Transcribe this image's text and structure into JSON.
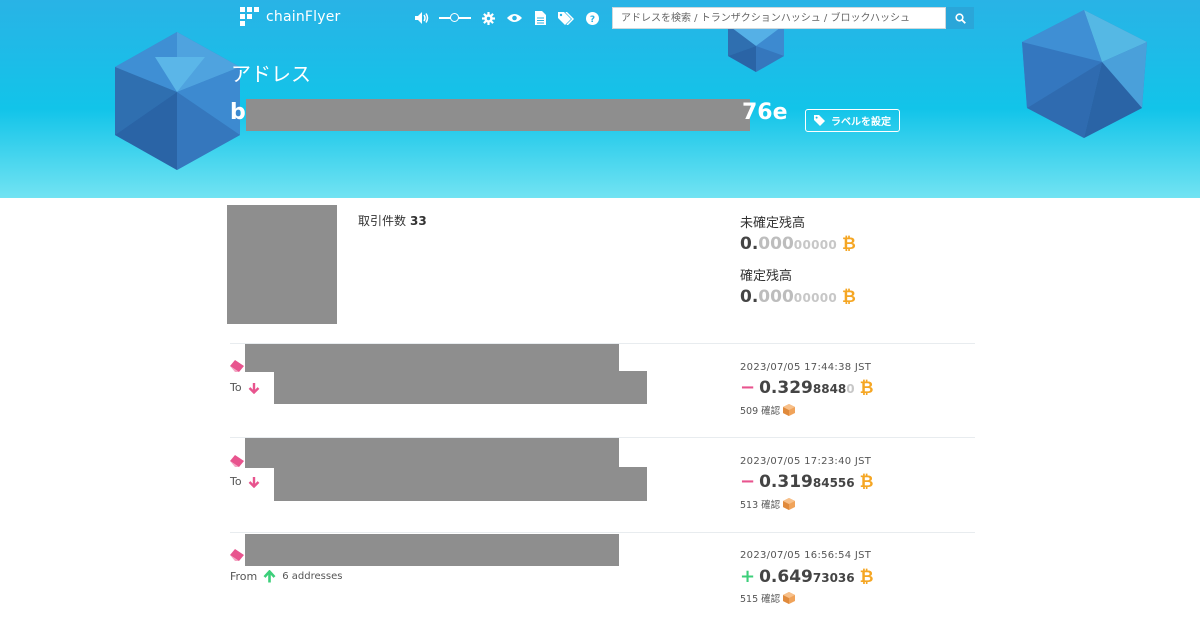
{
  "nav": {
    "logo": "chainFlyer",
    "search_placeholder": "アドレスを検索 / トランザクションハッシュ / ブロックハッシュ"
  },
  "header": {
    "title": "アドレス",
    "address_start": "b",
    "address_end": "76e",
    "label_button": "ラベルを設定"
  },
  "summary": {
    "tx_count_label": "取引件数",
    "tx_count": "33",
    "unconfirmed_label": "未確定残高",
    "unconfirmed_big": "0.",
    "unconfirmed_mid": "000",
    "unconfirmed_small": "00000",
    "confirmed_label": "確定残高",
    "confirmed_big": "0.",
    "confirmed_mid": "000",
    "confirmed_small": "00000"
  },
  "transactions": [
    {
      "direction": "To",
      "time": "2023/07/05 17:44:38 JST",
      "sign": "−",
      "amount_big": "0.329",
      "amount_small": "8848",
      "amount_zero": "0",
      "confirmations": "509 確認"
    },
    {
      "direction": "To",
      "time": "2023/07/05 17:23:40 JST",
      "sign": "−",
      "amount_big": "0.319",
      "amount_small": "84556",
      "amount_zero": "",
      "confirmations": "513 確認"
    },
    {
      "direction": "From",
      "addresses": "6 addresses",
      "time": "2023/07/05 16:56:54 JST",
      "sign": "+",
      "amount_big": "0.649",
      "amount_small": "73036",
      "amount_zero": "",
      "confirmations": "515 確認"
    }
  ],
  "colors": {
    "accent": "#29b3e6",
    "bitcoin": "#f5a623",
    "negative": "#e8548e",
    "positive": "#3ccf7a",
    "redaction": "#8e8e8e"
  },
  "icons": [
    "logo-icon",
    "speaker-icon",
    "gear-icon",
    "eye-icon",
    "document-icon",
    "tags-icon",
    "help-icon",
    "search-icon",
    "tag-icon",
    "bitcoin-icon",
    "eraser-icon",
    "arrow-down-icon",
    "arrow-up-icon",
    "block-icon"
  ]
}
